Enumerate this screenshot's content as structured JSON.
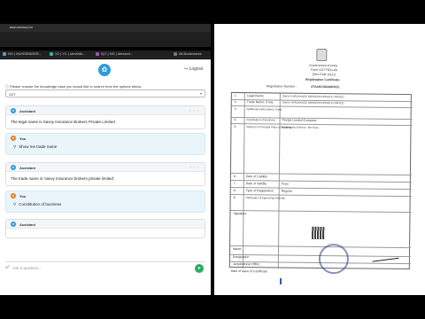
{
  "browser": {
    "window_title": "aservecloud.in",
    "tabs": [
      {
        "label": "aservecloud.in/ngl...",
        "color": "#5b9bd5",
        "active": true
      }
    ],
    "address": "aservecloud.in/ngbusplat",
    "bookmarks": [
      {
        "label": "NG | MUSSENDER..."
      },
      {
        "label": "X2 | YC | servthib..."
      },
      {
        "label": "IQ7 | NG | Messeri..."
      }
    ],
    "all_bookmarks": "All Bookmarks"
  },
  "app": {
    "logo_icon": "leaf-icon",
    "logout_label": "Logout",
    "instruction": "Please choose the knowledge base you would like to search from the options below",
    "knowledge_base_value": "G27",
    "messages": [
      {
        "role": "Assistant",
        "text": "The legal name is Savvy Insurance Brokers Private Limited",
        "type": "assistant"
      },
      {
        "role": "You",
        "text": "Show me trade name",
        "type": "user"
      },
      {
        "role": "Assistant",
        "text": "The trade name is 'savvy insurance brokers private limited'",
        "type": "assistant"
      },
      {
        "role": "You",
        "text": "Constitution of business",
        "type": "user"
      },
      {
        "role": "Assistant",
        "text": "",
        "type": "assistant"
      }
    ],
    "input_placeholder": "Ask a question..."
  },
  "viewer": {
    "title": "Government of India",
    "doc_heading": "Form GST REG-06",
    "doc_subheading": "[See Rule 10(1)]",
    "cert_title": "Registration Certificate",
    "reg_number_label": "Registration Number :",
    "reg_number_value": "27AAKCS8438N1ZL",
    "rows": [
      {
        "no": "1.",
        "label": "Legal Name",
        "value": "SAVVY INSURANCE BROKERS PRIVATE LIMITED"
      },
      {
        "no": "2.",
        "label": "Trade Name, if any",
        "value": "SAVVY INSURANCE BROKERS PRIVATE LIMITED"
      },
      {
        "no": "3.",
        "label": "Additional trade names, if any",
        "value": ""
      },
      {
        "no": "4.",
        "label": "Constitution of Business",
        "value": "Private Limited Company"
      },
      {
        "no": "5.",
        "label": "Address of Principal Place of Business",
        "value": "Building No./Flat No.: 9th Floor..."
      },
      {
        "no": "6.",
        "label": "Date of Liability",
        "value": ""
      },
      {
        "no": "7.",
        "label": "Date of Validity",
        "value": "From"
      },
      {
        "no": "8.",
        "label": "Type of Registration",
        "value": "Regular"
      },
      {
        "no": "9.",
        "label": "Particulars of Approving Authority",
        "value": ""
      }
    ],
    "signature_label": "Signature",
    "name_label": "Name",
    "designation_label": "Designation",
    "jurisdictional_office_label": "Jurisdictional Office",
    "date_of_issue_label": "Date of issue of Certificate"
  }
}
